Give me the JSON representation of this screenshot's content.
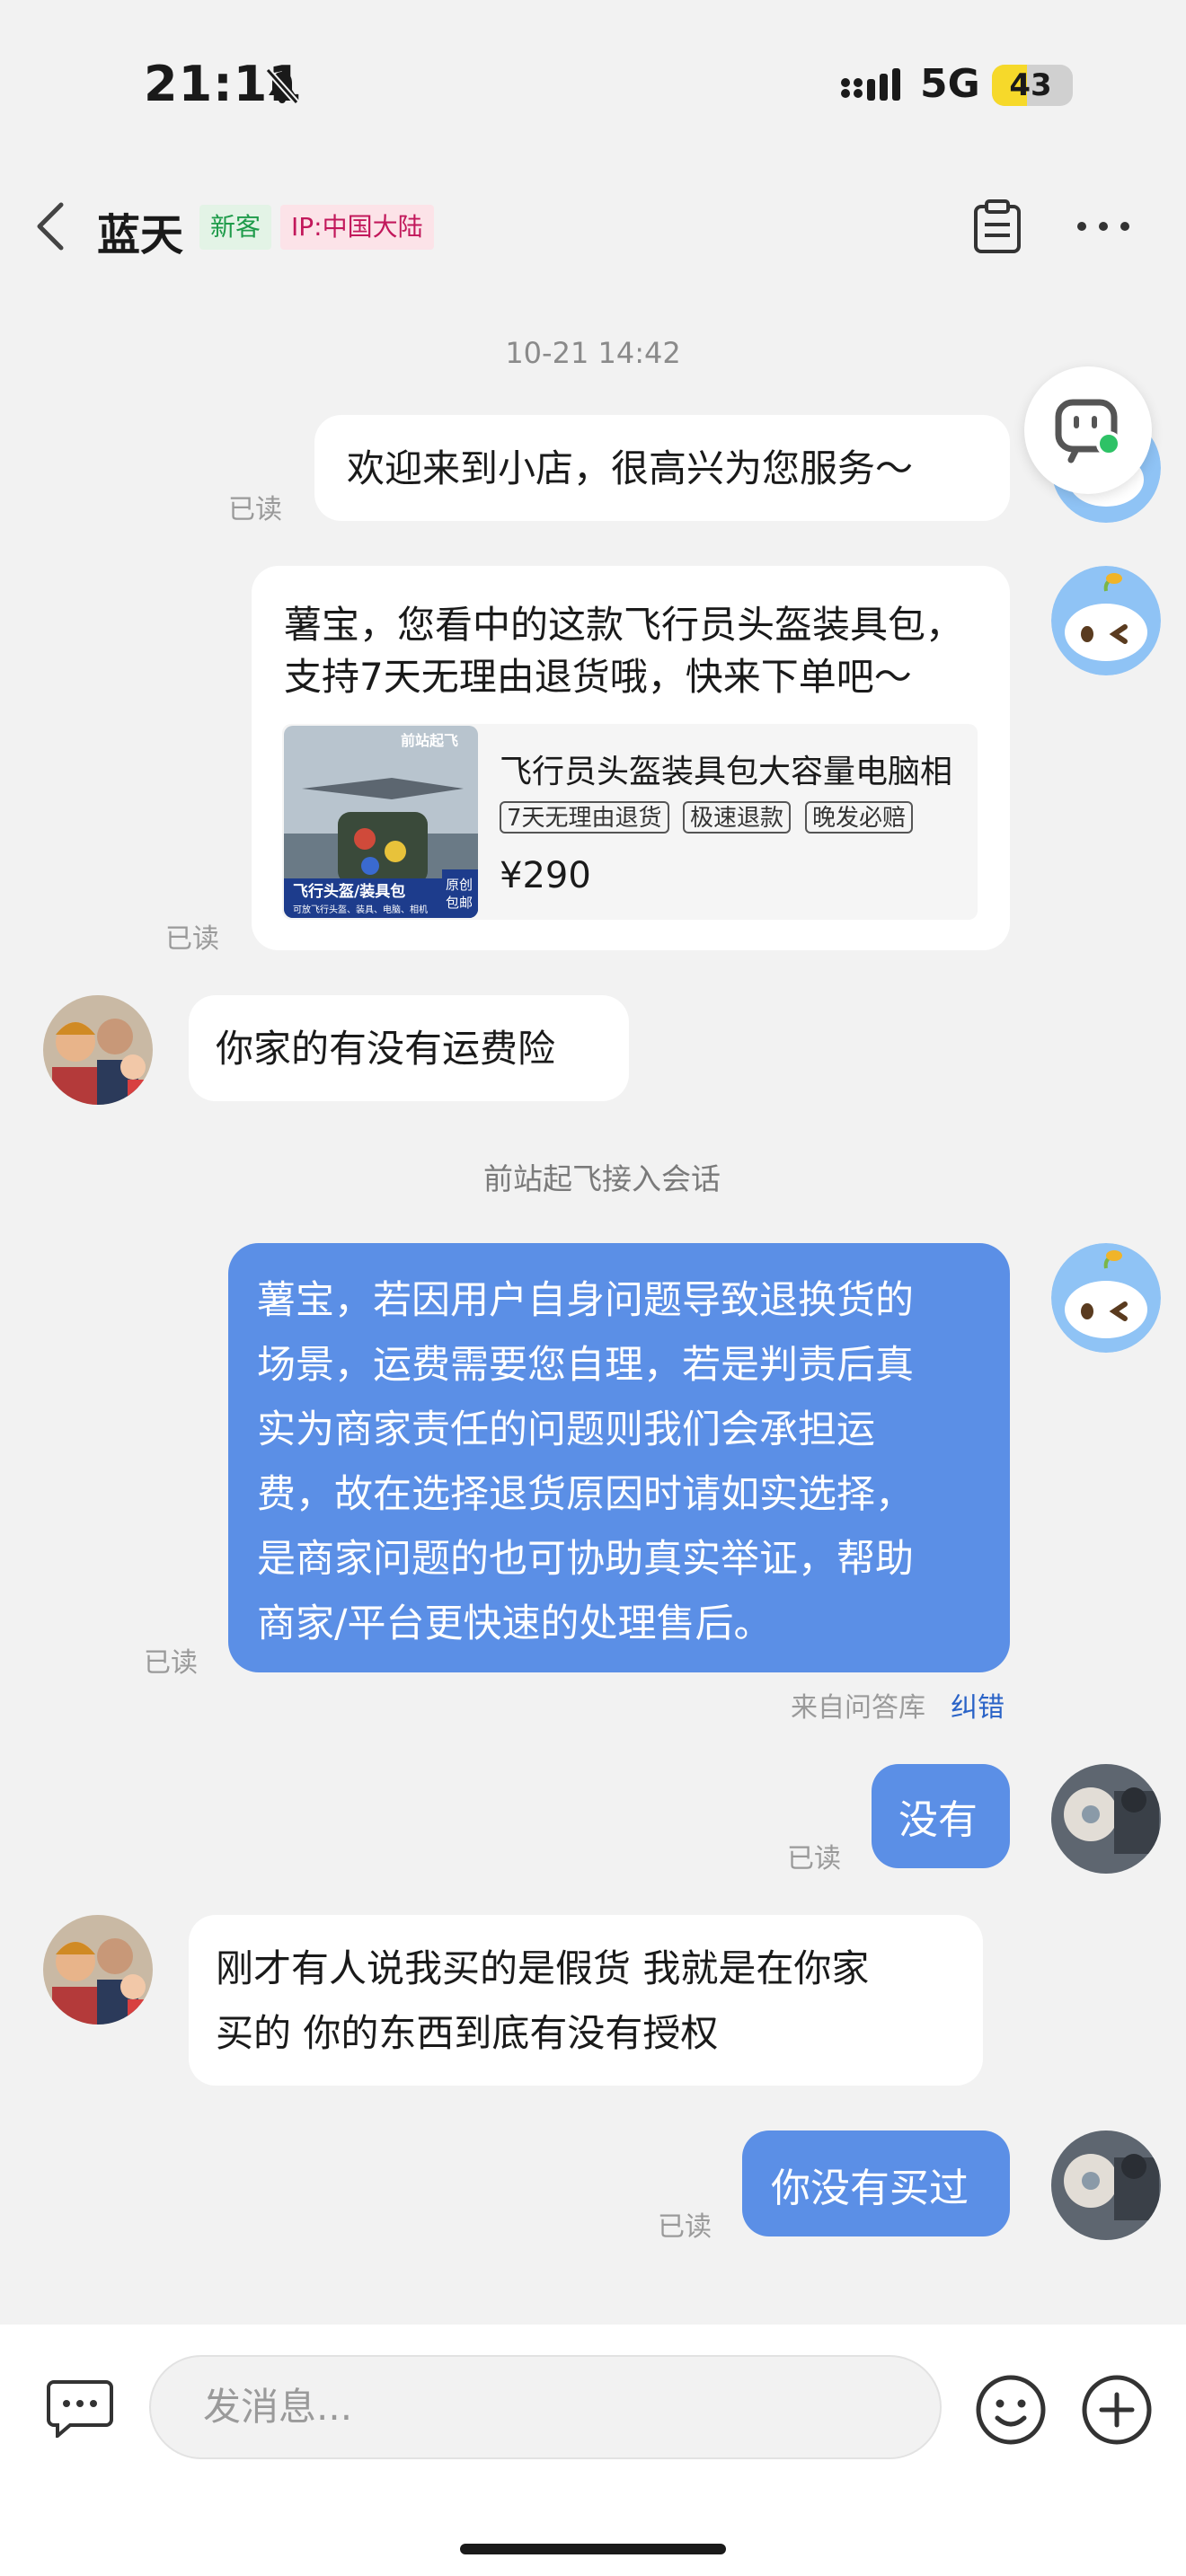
{
  "status_bar": {
    "time": "21:11",
    "network": "5G",
    "battery": "43",
    "battery_level": 0.43
  },
  "header": {
    "title": "蓝天",
    "tag_new": "新客",
    "tag_ip": "IP:中国大陆"
  },
  "chat": {
    "timestamp": "10-21 14:42",
    "read_label": "已读",
    "msg1": "欢迎来到小店，很高兴为您服务～",
    "card": {
      "line1": "薯宝，您看中的这款飞行员头盔装具包，",
      "line2": "支持7天无理由退货哦，快来下单吧～",
      "product_title": "飞行员头盔装具包大容量电脑相",
      "badges": [
        "7天无理由退货",
        "极速退款",
        "晚发必赔"
      ],
      "price": "¥290",
      "image_text_top": "前站起飞",
      "image_text_bottom": "飞行头盔/装具包",
      "image_text_sub": "可放飞行头盔、装具、电脑、相机",
      "image_badge": "原创\n包邮"
    },
    "customer_msg1": "你家的有没有运费险",
    "system_msg": "前站起飞接入会话",
    "auto_reply": {
      "lines": [
        "薯宝，若因用户自身问题导致退换货的",
        "场景，运费需要您自理，若是判责后真",
        "实为商家责任的问题则我们会承担运",
        "费，故在选择退货原因时请如实选择，",
        "是商家问题的也可协助真实举证，帮助",
        "商家/平台更快速的处理售后。"
      ],
      "source": "来自问答库",
      "correct": "纠错"
    },
    "msg_no": "没有",
    "customer_msg2_line1": "刚才有人说我买的是假货 我就是在你家",
    "customer_msg2_line2": "买的 你的东西到底有没有授权",
    "msg_not_bought": "你没有买过"
  },
  "input_bar": {
    "placeholder": "发消息..."
  },
  "colors": {
    "accent_blue": "#5b8fe6",
    "tag_green": "#1e9b4a",
    "tag_red": "#c2185b"
  },
  "icons": [
    "bell-slash-icon",
    "signal-icon",
    "back-icon",
    "document-icon",
    "more-icon",
    "bot-icon",
    "chat-icon",
    "emoji-icon",
    "plus-icon"
  ]
}
